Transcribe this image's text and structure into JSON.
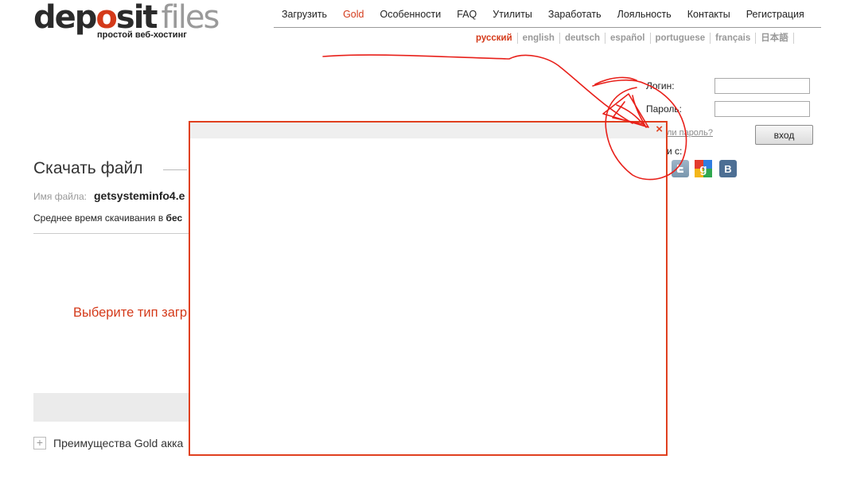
{
  "logo": {
    "part1": "dep",
    "part2": "o",
    "part3": "sit",
    "part4": "files",
    "tagline": "простой веб-хостинг"
  },
  "nav": [
    "Загрузить",
    "Gold",
    "Особенности",
    "FAQ",
    "Утилиты",
    "Заработать",
    "Лояльность",
    "Контакты",
    "Регистрация"
  ],
  "languages": [
    "русский",
    "english",
    "deutsch",
    "español",
    "portuguese",
    "français",
    "日本語"
  ],
  "login": {
    "login_label": "Логин:",
    "password_label": "Пароль:",
    "forgot_fragment": "ли пароль?",
    "enter_button": "вход",
    "enter_with_fragment": "и с:"
  },
  "main": {
    "title": "Скачать файл",
    "filename_label": "Имя файла:",
    "filename": "getsysteminfo4.e",
    "avg_time_prefix": "Среднее время скачивания в ",
    "avg_time_bold": "бес",
    "choose_type": "Выберите тип загр",
    "gold_advantages": "Преимущества Gold акка"
  },
  "popup": {
    "close_symbol": "×"
  },
  "colors": {
    "accent": "#d43a1a",
    "popup_border": "#e0401f",
    "scribble": "#e8201a"
  },
  "icons": [
    "twitter-icon",
    "google-icon",
    "vkontakte-icon",
    "close-icon",
    "plus-icon"
  ]
}
